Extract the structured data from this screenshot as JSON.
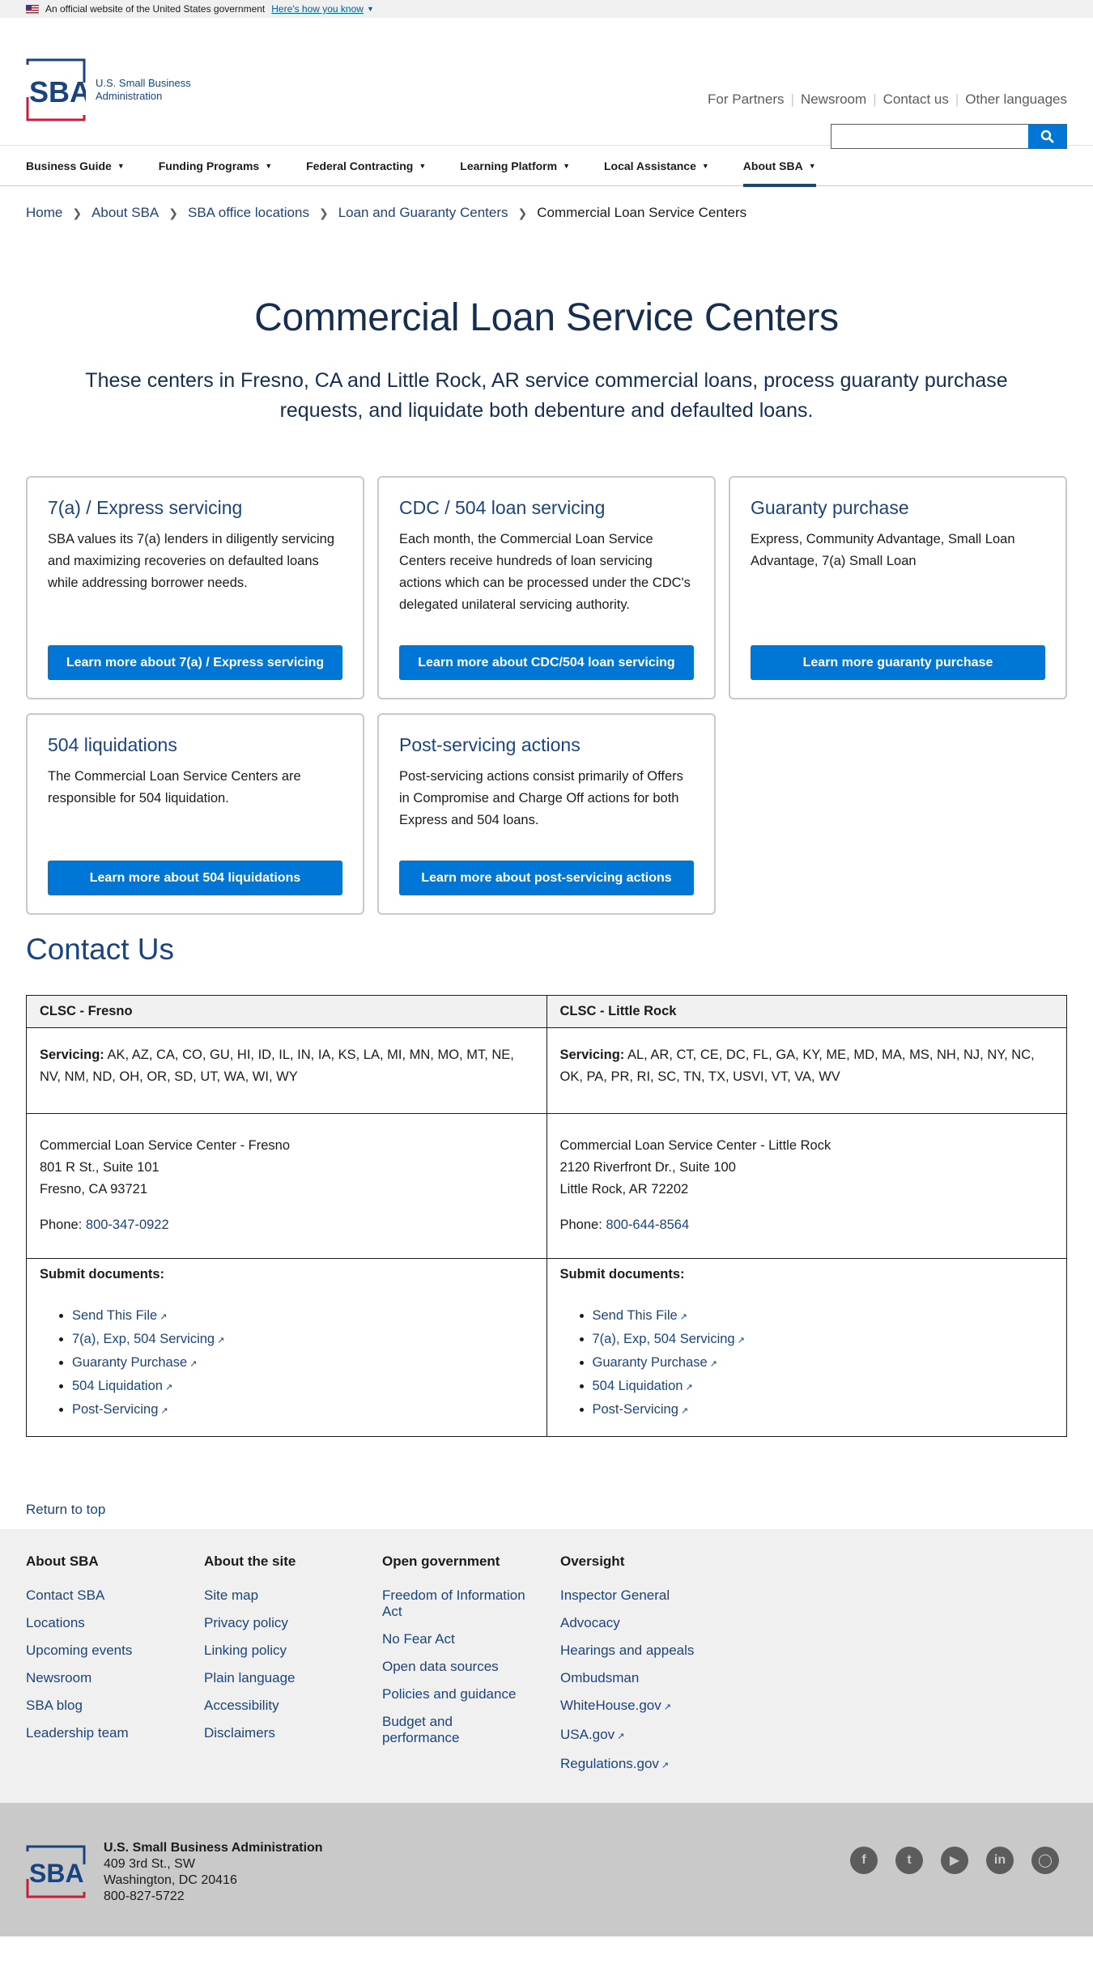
{
  "gov_banner": {
    "text": "An official website of the United States government",
    "how_link": "Here's how you know"
  },
  "logo": {
    "line1": "U.S. Small Business",
    "line2": "Administration"
  },
  "utility_nav": [
    "For Partners",
    "Newsroom",
    "Contact us",
    "Other languages"
  ],
  "main_nav": [
    {
      "label": "Business Guide"
    },
    {
      "label": "Funding Programs"
    },
    {
      "label": "Federal Contracting"
    },
    {
      "label": "Learning Platform"
    },
    {
      "label": "Local Assistance"
    },
    {
      "label": "About SBA",
      "active": true
    }
  ],
  "breadcrumb": [
    "Home",
    "About SBA",
    "SBA office locations",
    "Loan and Guaranty Centers",
    "Commercial Loan Service Centers"
  ],
  "page": {
    "title": "Commercial Loan Service Centers",
    "intro": "These centers in Fresno, CA and Little Rock, AR service commercial loans, process guaranty purchase requests, and liquidate both debenture and defaulted loans."
  },
  "cards": [
    {
      "title": "7(a) / Express servicing",
      "body": "SBA values its 7(a) lenders in diligently servicing and maximizing recoveries on defaulted loans while addressing borrower needs.",
      "button": "Learn more about 7(a) / Express servicing"
    },
    {
      "title": "CDC / 504 loan servicing",
      "body": "Each month, the Commercial Loan Service Centers receive hundreds of loan servicing actions which can be processed under the CDC's delegated unilateral servicing authority.",
      "button": "Learn more about CDC/504 loan servicing"
    },
    {
      "title": "Guaranty purchase",
      "body": "Express, Community Advantage, Small Loan Advantage, 7(a) Small Loan",
      "button": "Learn more guaranty purchase"
    },
    {
      "title": "504 liquidations",
      "body": "The Commercial Loan Service Centers are responsible for 504 liquidation.",
      "button": "Learn more about 504 liquidations"
    },
    {
      "title": "Post-servicing actions",
      "body": "Post-servicing actions consist primarily of Offers in Compromise and Charge Off actions for both Express and 504 loans.",
      "button": "Learn more about post-servicing actions"
    }
  ],
  "contact": {
    "title": "Contact Us",
    "servicing_label": "Servicing:",
    "phone_label": "Phone:",
    "submit_label": "Submit documents:",
    "centers": [
      {
        "header": "CLSC - Fresno",
        "servicing": "AK, AZ, CA, CO, GU, HI, ID, IL, IN, IA, KS, LA, MI, MN, MO, MT, NE, NV, NM, ND, OH, OR, SD, UT, WA, WI, WY",
        "address1": "Commercial Loan Service Center - Fresno",
        "address2": "801 R St., Suite 101",
        "address3": "Fresno, CA 93721",
        "phone": "800-347-0922",
        "links": [
          "Send This File",
          "7(a), Exp, 504 Servicing",
          "Guaranty Purchase",
          "504 Liquidation",
          "Post-Servicing"
        ]
      },
      {
        "header": "CLSC - Little Rock",
        "servicing": "AL, AR, CT, CE, DC, FL, GA, KY, ME, MD, MA, MS, NH, NJ, NY, NC, OK, PA, PR, RI, SC, TN, TX, USVI, VT, VA, WV",
        "address1": "Commercial Loan Service Center - Little Rock",
        "address2": "2120 Riverfront Dr., Suite 100",
        "address3": "Little Rock, AR 72202",
        "phone": "800-644-8564",
        "links": [
          "Send This File",
          "7(a), Exp, 504 Servicing",
          "Guaranty Purchase",
          "504 Liquidation",
          "Post-Servicing"
        ]
      }
    ]
  },
  "return_to_top": "Return to top",
  "footer": {
    "columns": [
      {
        "heading": "About SBA",
        "links": [
          "Contact SBA",
          "Locations",
          "Upcoming events",
          "Newsroom",
          "SBA blog",
          "Leadership team"
        ]
      },
      {
        "heading": "About the site",
        "links": [
          "Site map",
          "Privacy policy",
          "Linking policy",
          "Plain language",
          "Accessibility",
          "Disclaimers"
        ]
      },
      {
        "heading": "Open government",
        "links": [
          "Freedom of Information Act",
          "No Fear Act",
          "Open data sources",
          "Policies and guidance",
          "Budget and performance"
        ]
      },
      {
        "heading": "Oversight",
        "links": [
          "Inspector General",
          "Advocacy",
          "Hearings and appeals",
          "Ombudsman",
          "WhiteHouse.gov",
          "USA.gov",
          "Regulations.gov"
        ]
      }
    ],
    "org_name": "U.S. Small Business Administration",
    "address1": "409 3rd St., SW",
    "address2": "Washington, DC 20416",
    "phone": "800-827-5722",
    "socials": [
      "facebook-icon",
      "twitter-icon",
      "youtube-icon",
      "linkedin-icon",
      "instagram-icon"
    ]
  },
  "colors": {
    "primary": "#1a4480",
    "button": "#0076d6",
    "title": "#162e51",
    "footer_bg": "#f0f0f0",
    "footer_bottom_bg": "#c9c9c9"
  }
}
